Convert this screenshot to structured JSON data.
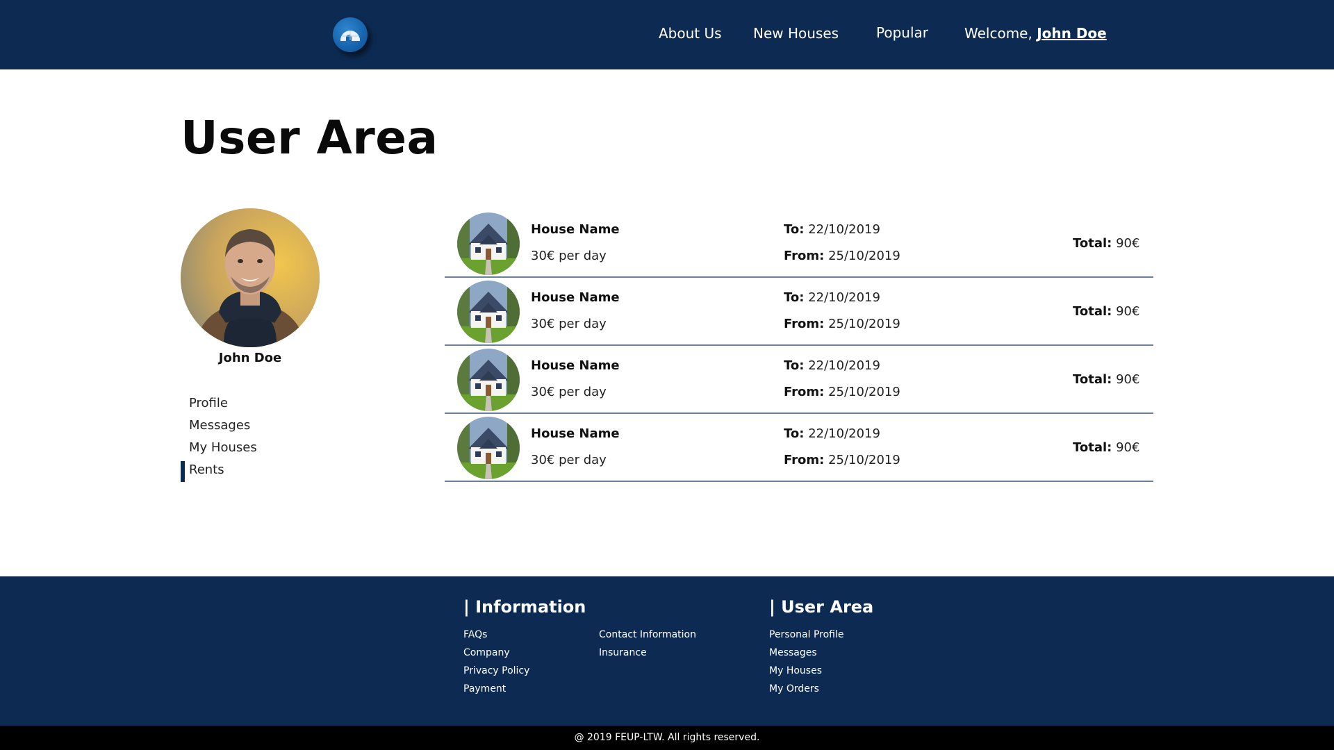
{
  "header": {
    "nav": [
      "About Us",
      "New Houses",
      "Popular"
    ],
    "welcome_prefix": "Welcome,",
    "user_name": "John Doe"
  },
  "page": {
    "title": "User Area"
  },
  "sidebar": {
    "name": "John Doe",
    "menu": [
      "Profile",
      "Messages",
      "My Houses",
      "Rents"
    ],
    "active": "Rents"
  },
  "rents": [
    {
      "house_name": "House Name",
      "price": "30€ per day",
      "to_label": "To:",
      "to": "22/10/2019",
      "from_label": "From:",
      "from": "25/10/2019",
      "total_label": "Total:",
      "total": "90€"
    },
    {
      "house_name": "House Name",
      "price": "30€ per day",
      "to_label": "To:",
      "to": "22/10/2019",
      "from_label": "From:",
      "from": "25/10/2019",
      "total_label": "Total:",
      "total": "90€"
    },
    {
      "house_name": "House Name",
      "price": "30€ per day",
      "to_label": "To:",
      "to": "22/10/2019",
      "from_label": "From:",
      "from": "25/10/2019",
      "total_label": "Total:",
      "total": "90€"
    },
    {
      "house_name": "House Name",
      "price": "30€ per day",
      "to_label": "To:",
      "to": "22/10/2019",
      "from_label": "From:",
      "from": "25/10/2019",
      "total_label": "Total:",
      "total": "90€"
    }
  ],
  "footer": {
    "information": {
      "heading": "| Information",
      "col1": [
        "FAQs",
        "Company",
        "Privacy Policy",
        "Payment"
      ],
      "col2": [
        "Contact Information",
        "Insurance"
      ]
    },
    "user_area": {
      "heading": "| User Area",
      "links": [
        "Personal Profile",
        "Messages",
        "My Houses",
        "My Orders"
      ]
    },
    "copyright": "@ 2019 FEUP-LTW. All rights reserved."
  },
  "colors": {
    "header_bg": "#0d2b52",
    "footer_bg": "#0d2b52",
    "copyright_bg": "#000000",
    "logo": "#1663ad"
  }
}
